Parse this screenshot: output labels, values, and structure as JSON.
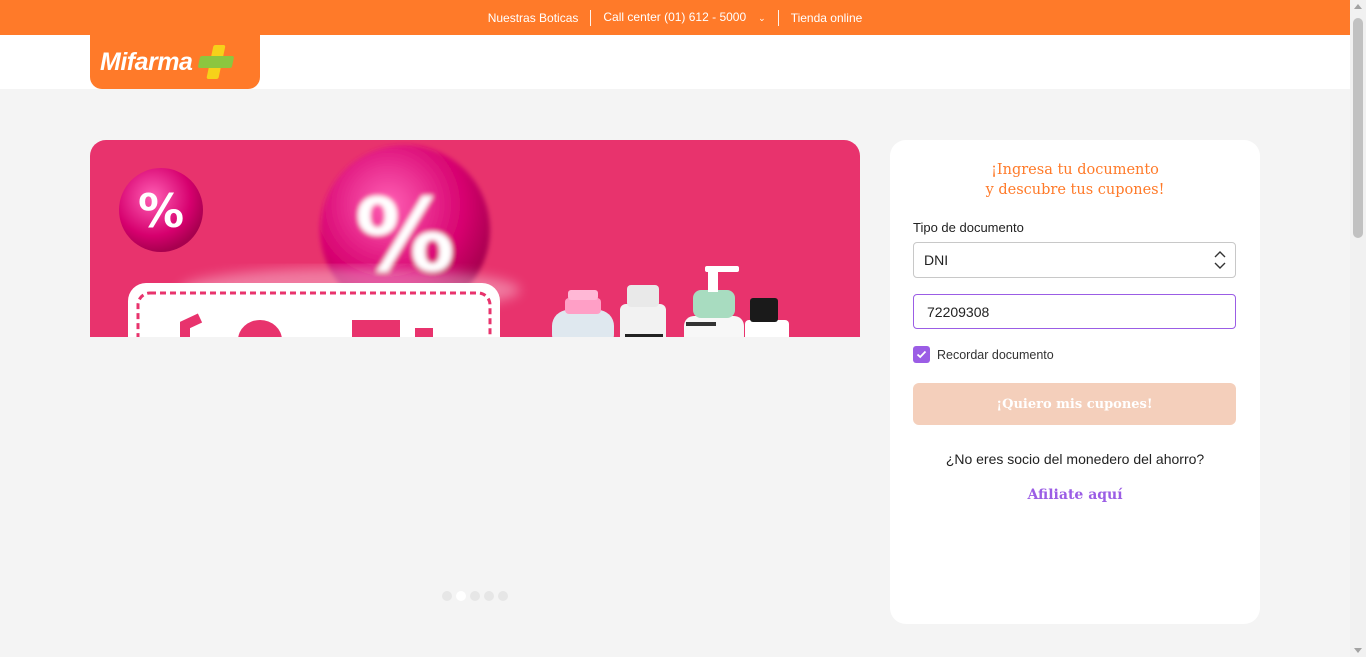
{
  "topbar": {
    "store_link": "Nuestras Boticas",
    "call_center": "Call center (01) 612 - 5000",
    "online_store": "Tienda online"
  },
  "logo": {
    "text": "Mifarma"
  },
  "carousel": {
    "slides": 5,
    "active_index": 1
  },
  "form": {
    "title": "¡Ingresa tu documento y descubre tus cupones!",
    "doc_type_label": "Tipo de documento",
    "doc_type_value": "DNI",
    "doc_number_value": "72209308",
    "remember_label": "Recordar documento",
    "remember_checked": true,
    "submit_label": "¡Quiero mis cupones!",
    "not_member_text": "¿No eres socio del monedero del ahorro?",
    "affiliate_link": "Afiliate aquí"
  },
  "colors": {
    "brand_orange": "#ff7a29",
    "accent_purple": "#9b5de5",
    "banner_pink": "#e8336d",
    "button_disabled": "#f4cfbb"
  }
}
